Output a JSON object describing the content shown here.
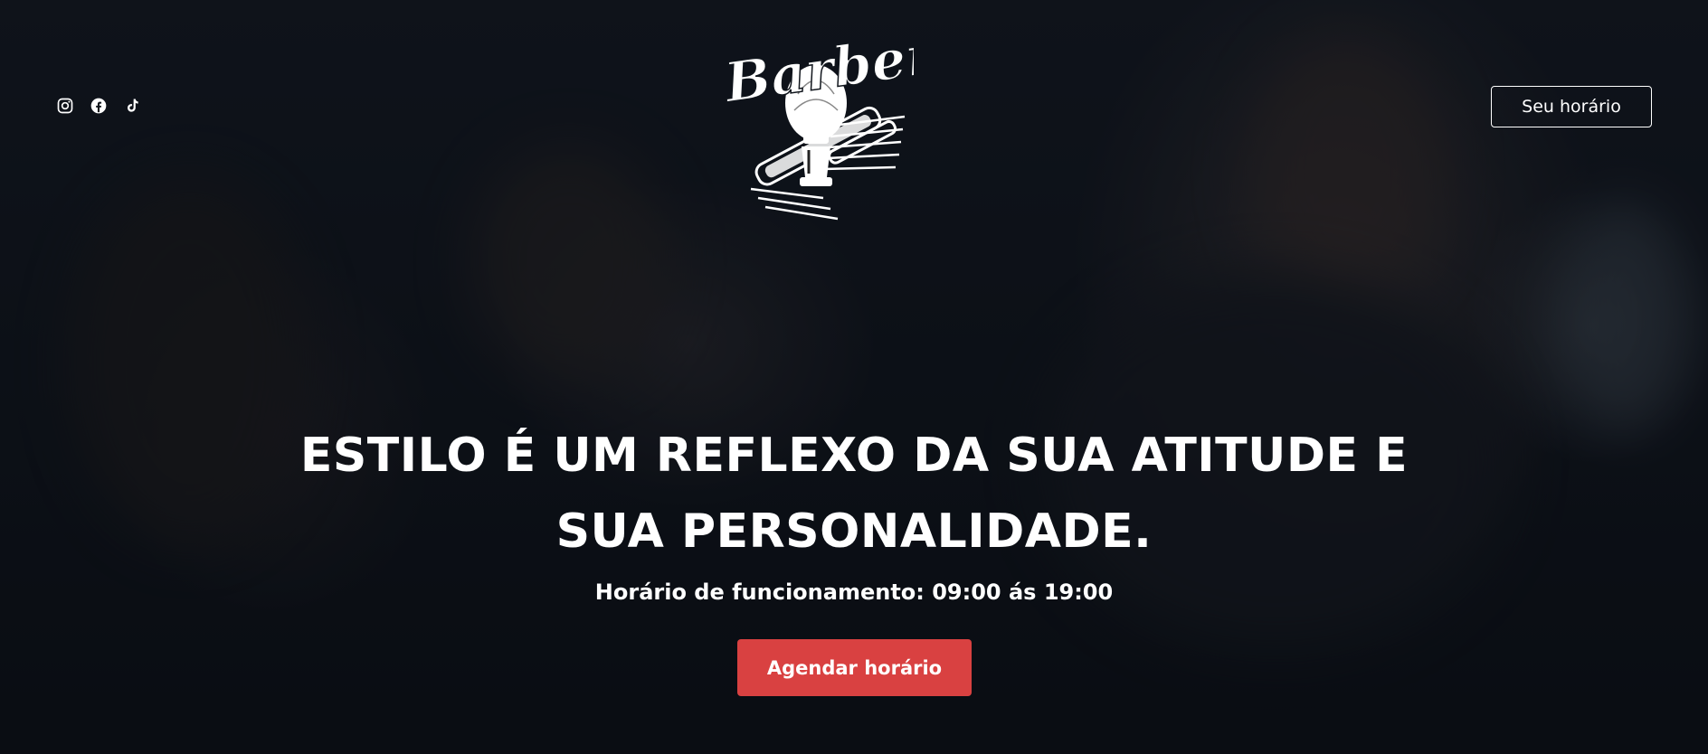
{
  "header": {
    "socials": [
      {
        "icon": "instagram-icon"
      },
      {
        "icon": "facebook-icon"
      },
      {
        "icon": "tiktok-icon"
      }
    ],
    "logo": {
      "text": "Barber"
    },
    "cta_label": "Seu horário"
  },
  "hero": {
    "headline_line1": "ESTILO É UM REFLEXO DA SUA ATITUDE E",
    "headline_line2": "SUA PERSONALIDADE.",
    "hours": "Horário de funcionamento: 09:00 ás 19:00",
    "cta_label": "Agendar horário"
  },
  "colors": {
    "accent": "#d94141",
    "text": "#ffffff",
    "overlay": "#0d1117"
  }
}
